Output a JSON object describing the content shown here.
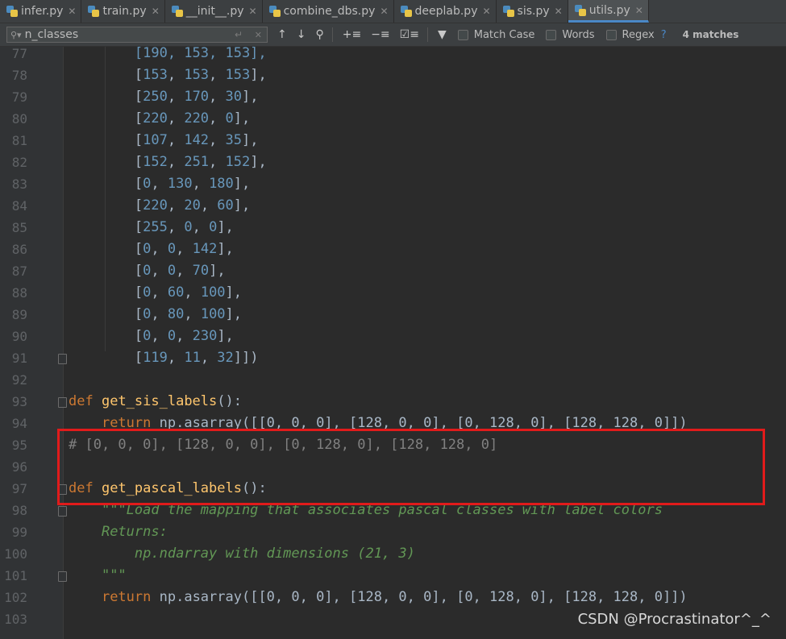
{
  "tabs": [
    {
      "label": "infer.py",
      "active": false
    },
    {
      "label": "train.py",
      "active": false
    },
    {
      "label": "__init__.py",
      "active": false
    },
    {
      "label": "combine_dbs.py",
      "active": false
    },
    {
      "label": "deeplab.py",
      "active": false
    },
    {
      "label": "sis.py",
      "active": false
    },
    {
      "label": "utils.py",
      "active": true
    }
  ],
  "find": {
    "query": "n_classes",
    "match_case_label": "Match Case",
    "words_label": "Words",
    "regex_label": "Regex",
    "help": "?",
    "matches": "4 matches"
  },
  "editor": {
    "line_numbers": [
      "77",
      "78",
      "79",
      "80",
      "81",
      "82",
      "83",
      "84",
      "85",
      "86",
      "87",
      "88",
      "89",
      "90",
      "91",
      "92",
      "93",
      "94",
      "95",
      "96",
      "97",
      "98",
      "99",
      "100",
      "101",
      "102",
      "103"
    ],
    "lines": {
      "l77": "[190, 153, 153],",
      "l78": [
        "153",
        "153",
        "153"
      ],
      "l79": [
        "250",
        "170",
        "30"
      ],
      "l80": [
        "220",
        "220",
        "0"
      ],
      "l81": [
        "107",
        "142",
        "35"
      ],
      "l82": [
        "152",
        "251",
        "152"
      ],
      "l83": [
        "0",
        "130",
        "180"
      ],
      "l84": [
        "220",
        "20",
        "60"
      ],
      "l85": [
        "255",
        "0",
        "0"
      ],
      "l86": [
        "0",
        "0",
        "142"
      ],
      "l87": [
        "0",
        "0",
        "70"
      ],
      "l88": [
        "0",
        "60",
        "100"
      ],
      "l89": [
        "0",
        "80",
        "100"
      ],
      "l90": [
        "0",
        "0",
        "230"
      ],
      "l91": [
        "119",
        "11",
        "32"
      ],
      "l93_kw": "def",
      "l93_fn": "get_sis_labels",
      "l93_rest": "():",
      "l94_kw": "return",
      "l94_rest": "np.asarray([[0, 0, 0], [128, 0, 0], [0, 128, 0], [128, 128, 0]])",
      "l95": "# [0, 0, 0], [128, 0, 0], [0, 128, 0], [128, 128, 0]",
      "l97_kw": "def",
      "l97_fn": "get_pascal_labels",
      "l97_rest": "():",
      "l98": "\"\"\"Load the mapping that associates pascal classes with label colors",
      "l99": "Returns:",
      "l100": "np.ndarray with dimensions (21, 3)",
      "l101": "\"\"\"",
      "l102_kw": "return",
      "l102_rest": "np.asarray([[0, 0, 0], [128, 0, 0], [0, 128, 0], [128, 128, 0]])"
    }
  },
  "watermark": "CSDN @Procrastinator^_^",
  "colors": {
    "highlight_box": "#e11b1b",
    "keyword": "#cc7832",
    "function": "#ffc66d",
    "number": "#6897bb",
    "comment": "#808080",
    "docstring": "#629755"
  }
}
